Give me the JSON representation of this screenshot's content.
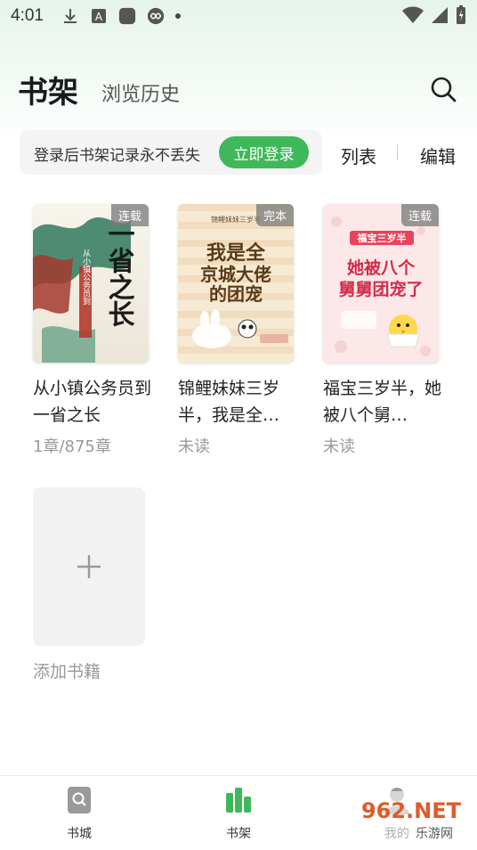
{
  "status_bar": {
    "time": "4:01"
  },
  "header": {
    "title": "书架",
    "subtitle": "浏览历史"
  },
  "login_banner": {
    "text": "登录后书架记录永不丢失",
    "button_label": "立即登录"
  },
  "actions": {
    "list_label": "列表",
    "edit_label": "编辑"
  },
  "books": [
    {
      "title": "从小镇公务员到一省之长",
      "badge": "连载",
      "progress": "1章/875章",
      "cover_title": "一省之长",
      "cover_subtitle": "从小镇公务员到"
    },
    {
      "title": "锦鲤妹妹三岁半，我是全…",
      "badge": "完本",
      "progress": "未读",
      "cover_title": "我是全京城大佬的团宠",
      "cover_subtitle": "锦鲤妹妹三岁半"
    },
    {
      "title": "福宝三岁半，她被八个舅…",
      "badge": "连载",
      "progress": "未读",
      "cover_title": "她被八个舅舅团宠了",
      "cover_subtitle": "福宝三岁半"
    }
  ],
  "add_book": {
    "label": "添加书籍",
    "plus": "+"
  },
  "bottom_nav": [
    {
      "label": "书城",
      "icon": "store-icon"
    },
    {
      "label": "书架",
      "icon": "bookshelf-icon",
      "active": true
    },
    {
      "label": "我的",
      "icon": "profile-icon"
    }
  ],
  "watermark": {
    "line1": "962.NET",
    "line2": "乐游网"
  },
  "colors": {
    "accent": "#3fb85a",
    "badge_bg": "#7a7a7a",
    "muted_text": "#999999"
  }
}
